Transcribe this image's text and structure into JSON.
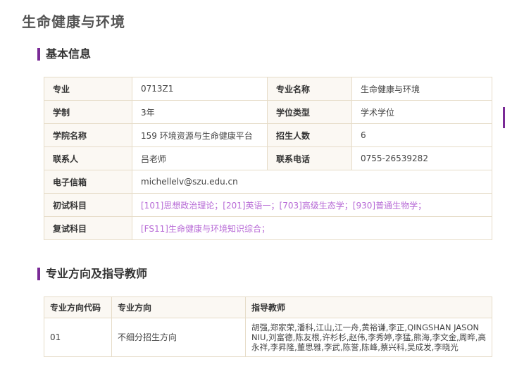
{
  "page": {
    "title": "生命健康与环境"
  },
  "sections": {
    "basic": "基本信息",
    "direction": "专业方向及指导教师"
  },
  "basic_info": {
    "major_code_label": "专业",
    "major_code": "0713Z1",
    "major_name_label": "专业名称",
    "major_name": "生命健康与环境",
    "duration_label": "学制",
    "duration": "3年",
    "degree_type_label": "学位类型",
    "degree_type": "学术学位",
    "college_label": "学院名称",
    "college": "159 环境资源与生命健康平台",
    "enrollment_label": "招生人数",
    "enrollment": "6",
    "contact_label": "联系人",
    "contact": "吕老师",
    "phone_label": "联系电话",
    "phone": "0755-26539282",
    "email_label": "电子信箱",
    "email": "michellelv@szu.edu.cn",
    "prelim_label": "初试科目",
    "prelim": "[101]思想政治理论；[201]英语一；[703]高级生态学；[930]普通生物学；",
    "retest_label": "复试科目",
    "retest": "[FS11]生命健康与环境知识综合；"
  },
  "direction_table": {
    "headers": [
      "专业方向代码",
      "专业方向",
      "指导教师"
    ],
    "rows": [
      {
        "code": "01",
        "direction": "不细分招生方向",
        "teachers": "胡强,郑家荣,潘科,江山,江一舟,黄裕谦,李正,QINGSHAN JASON NIU,刘富德,陈友根,许杉杉,赵伟,李秀婷,李猛,熊海,李文金,周晔,高永祥,李昇隆,董思雅,李武,陈誉,陈峰,蔡兴科,吴成发,李晓光"
      }
    ]
  }
}
